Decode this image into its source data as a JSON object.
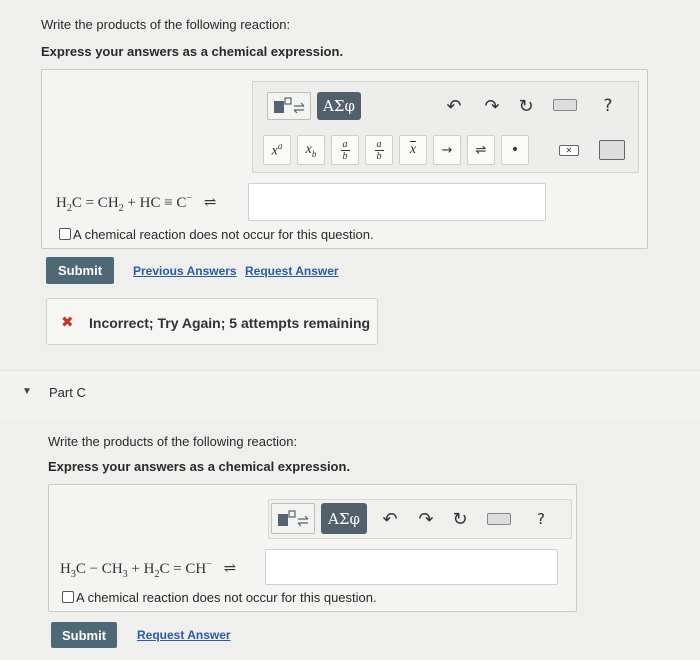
{
  "partB": {
    "prompt": "Write the products of the following reaction:",
    "instruction": "Express your answers as a chemical expression.",
    "toolbar": {
      "greek_label": "ΑΣφ",
      "template_labels": [
        "x",
        "a",
        "x",
        "b",
        "a",
        "b",
        "a",
        "b",
        "x"
      ],
      "help_label": "?"
    },
    "equation": {
      "left": "H",
      "sub1": "2",
      "mid1": "C = CH",
      "sub2": "2",
      "mid2": " + HC ≡ C",
      "sup1": "−",
      "arrow": "⇌"
    },
    "no_reaction_label": "A chemical reaction does not occur for this question.",
    "submit_label": "Submit",
    "previous_answers_label": "Previous Answers",
    "request_answer_label": "Request Answer",
    "feedback": {
      "icon": "✖",
      "text": "Incorrect; Try Again; 5 attempts remaining",
      "color": "#c0392b"
    }
  },
  "partC": {
    "title": "Part C",
    "prompt": "Write the products of the following reaction:",
    "instruction": "Express your answers as a chemical expression.",
    "toolbar": {
      "greek_label": "ΑΣφ",
      "help_label": "?"
    },
    "equation": {
      "left": "H",
      "sub1": "3",
      "mid1": "C − CH",
      "sub2": "3",
      "mid2": " + H",
      "sub3": "2",
      "mid3": "C = CH",
      "sup1": "−",
      "arrow": "⇌"
    },
    "no_reaction_label": "A chemical reaction does not occur for this question.",
    "submit_label": "Submit",
    "request_answer_label": "Request Answer"
  },
  "colors": {
    "submit_bg": "#4e6876",
    "link": "#2b5ba8",
    "error": "#c0392b"
  }
}
